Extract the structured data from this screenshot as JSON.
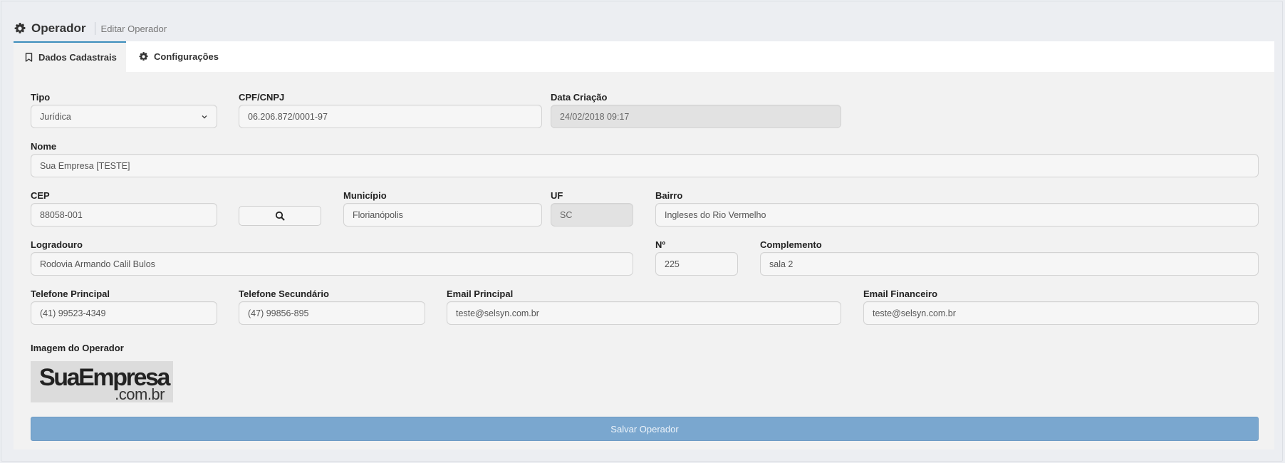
{
  "header": {
    "title": "Operador",
    "subtitle": "Editar Operador",
    "icon": "gear-icon"
  },
  "tabs": [
    {
      "label": "Dados Cadastrais",
      "icon": "bookmark-icon",
      "active": true
    },
    {
      "label": "Configurações",
      "icon": "gear-icon",
      "active": false
    }
  ],
  "form": {
    "tipo": {
      "label": "Tipo",
      "value": "Jurídica"
    },
    "cpf_cnpj": {
      "label": "CPF/CNPJ",
      "value": "06.206.872/0001-97"
    },
    "data_criacao": {
      "label": "Data Criação",
      "value": "24/02/2018 09:17"
    },
    "nome": {
      "label": "Nome",
      "value": "Sua Empresa [TESTE]"
    },
    "cep": {
      "label": "CEP",
      "value": "88058-001"
    },
    "municipio": {
      "label": "Município",
      "value": "Florianópolis"
    },
    "uf": {
      "label": "UF",
      "value": "SC"
    },
    "bairro": {
      "label": "Bairro",
      "value": "Ingleses do Rio Vermelho"
    },
    "logradouro": {
      "label": "Logradouro",
      "value": "Rodovia Armando Calil Bulos"
    },
    "numero": {
      "label": "Nº",
      "value": "225"
    },
    "complemento": {
      "label": "Complemento",
      "value": "sala 2"
    },
    "telefone_principal": {
      "label": "Telefone Principal",
      "value": "(41) 99523-4349"
    },
    "telefone_secundario": {
      "label": "Telefone Secundário",
      "value": "(47) 99856-895"
    },
    "email_principal": {
      "label": "Email Principal",
      "value": "teste@selsyn.com.br"
    },
    "email_financeiro": {
      "label": "Email Financeiro",
      "value": "teste@selsyn.com.br"
    },
    "imagem": {
      "label": "Imagem do Operador",
      "logo_line1": "SuaEmpresa",
      "logo_line2": ".com.br"
    },
    "save_label": "Salvar Operador"
  },
  "colors": {
    "save_button": "#7aa7cf",
    "tab_active_border": "#3c8dbc",
    "page_background": "#eceef2"
  }
}
